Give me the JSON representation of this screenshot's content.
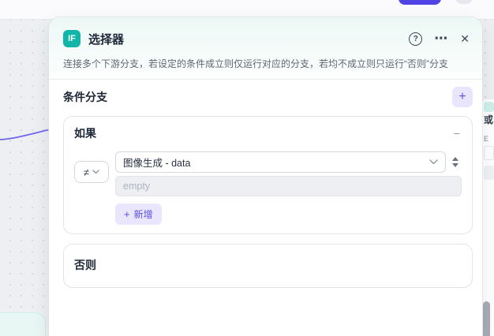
{
  "colors": {
    "node_teal": "#12b5a8",
    "accent_indigo": "#5a50e0",
    "edge_purple": "#6e65f4"
  },
  "panel": {
    "badge_label": "IF",
    "title": "选择器",
    "help_icon": "?",
    "more_icon": "⋯",
    "close_icon": "✕",
    "description": "连接多个下游分支，若设定的条件成立则仅运行对应的分支，若均不成立则只运行“否则”分支",
    "section_title": "条件分支",
    "add_branch_icon": "+",
    "if_card": {
      "label": "如果",
      "collapse_icon": "−",
      "operator": "≠",
      "variable_value": "图像生成 - data",
      "value_placeholder": "empty",
      "add_icon": "+",
      "add_label": "新增"
    },
    "else_card": {
      "label": "否则"
    }
  },
  "background_right_panel": {
    "partial_title": "或",
    "partial_label": "E"
  }
}
